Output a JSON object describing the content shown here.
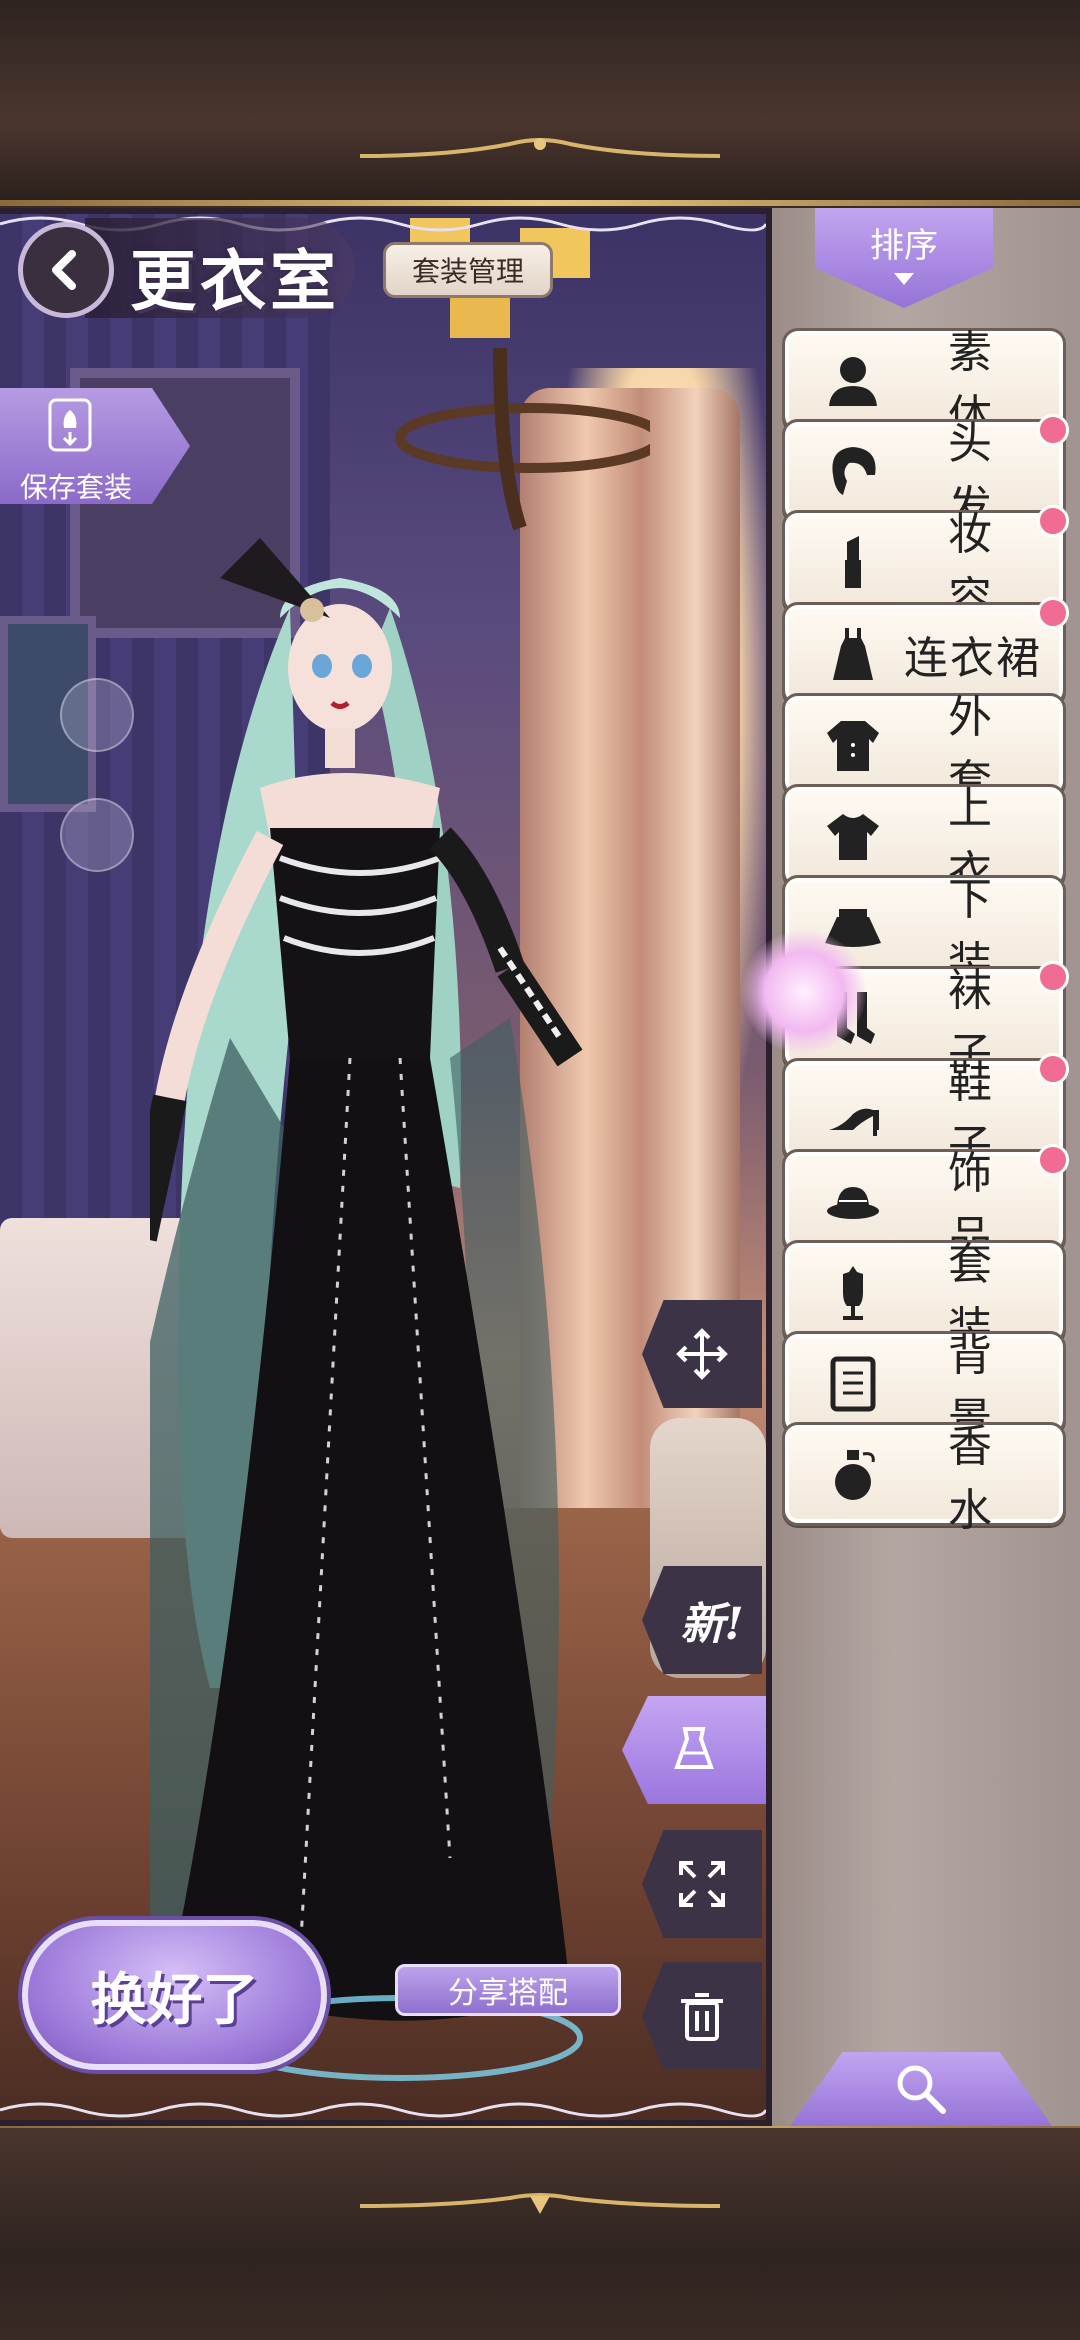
{
  "header": {
    "title": "更衣室",
    "suit_management": "套装管理"
  },
  "save": {
    "label": "保存套装"
  },
  "actions": {
    "done": "换好了",
    "share": "分享搭配"
  },
  "tools": {
    "new_label": "新!"
  },
  "panel": {
    "sort_label": "排序",
    "categories": [
      {
        "label": "素 体",
        "icon": "body-silhouette-icon",
        "new": false
      },
      {
        "label": "头 发",
        "icon": "hair-icon",
        "new": true
      },
      {
        "label": "妆 容",
        "icon": "lipstick-icon",
        "new": true
      },
      {
        "label": "连衣裙",
        "icon": "dress-icon",
        "new": true
      },
      {
        "label": "外 套",
        "icon": "coat-icon",
        "new": false
      },
      {
        "label": "上 衣",
        "icon": "top-icon",
        "new": false
      },
      {
        "label": "下 装",
        "icon": "skirt-icon",
        "new": false
      },
      {
        "label": "袜 子",
        "icon": "socks-icon",
        "new": true
      },
      {
        "label": "鞋 子",
        "icon": "high-heel-icon",
        "new": true
      },
      {
        "label": "饰 品",
        "icon": "hat-icon",
        "new": true
      },
      {
        "label": "套 装",
        "icon": "mannequin-icon",
        "new": false
      },
      {
        "label": "背 景",
        "icon": "background-card-icon",
        "new": false
      },
      {
        "label": "香 水",
        "icon": "perfume-icon",
        "new": false
      }
    ]
  },
  "colors": {
    "accent": "#9b76de",
    "badge": "#f06c93",
    "panel": "#b4a7a2"
  }
}
